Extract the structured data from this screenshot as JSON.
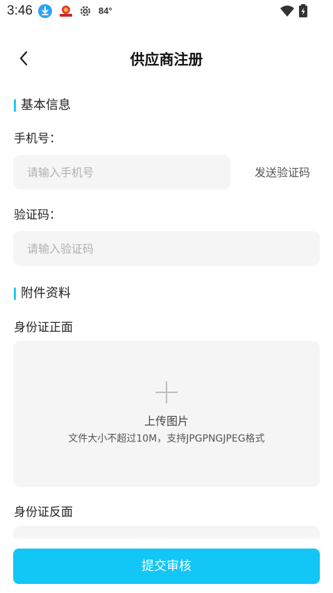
{
  "status_bar": {
    "time": "3:46",
    "temperature": "84°",
    "icons": [
      "download-icon",
      "app-badge-icon",
      "settings-gear-icon",
      "wifi-icon",
      "battery-charging-icon"
    ]
  },
  "header": {
    "title": "供应商注册",
    "back_icon": "chevron-left-icon"
  },
  "basic_info": {
    "section_title": "基本信息",
    "phone": {
      "label": "手机号：",
      "placeholder": "请输入手机号",
      "value": ""
    },
    "send_code_label": "发送验证码",
    "code": {
      "label": "验证码：",
      "placeholder": "请输入验证码",
      "value": ""
    }
  },
  "attachments": {
    "section_title": "附件资料",
    "id_front": {
      "label": "身份证正面",
      "upload_label": "上传图片",
      "upload_hint": "文件大小不超过10M，支持JPGPNGJPEG格式"
    },
    "id_back": {
      "label": "身份证反面"
    }
  },
  "footer": {
    "submit_label": "提交审核"
  },
  "colors": {
    "accent": "#12c6f5",
    "section_marker": "#1ec8f5",
    "input_bg": "#f5f5f5"
  }
}
